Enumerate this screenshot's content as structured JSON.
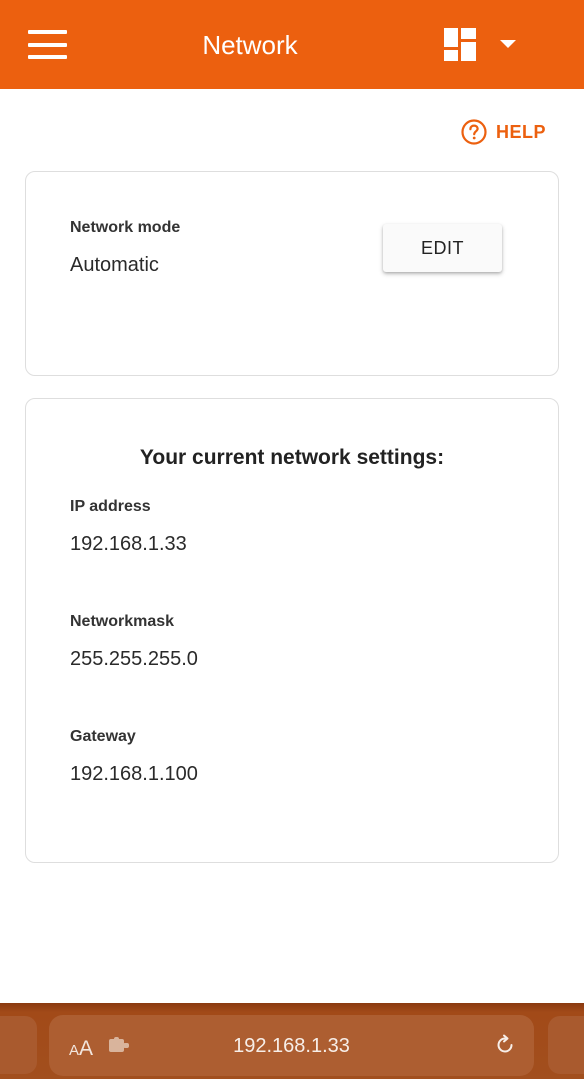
{
  "header": {
    "title": "Network",
    "menu_icon": "hamburger-menu-icon",
    "dashboard_icon": "dashboard-layout-icon",
    "dropdown_icon": "caret-down-icon",
    "background": "#ec600f"
  },
  "help": {
    "label": "HELP",
    "icon": "question-circle-icon",
    "color": "#ec600f"
  },
  "network_mode": {
    "label": "Network mode",
    "value": "Automatic",
    "edit_label": "EDIT"
  },
  "current_settings": {
    "title": "Your current network settings:",
    "fields": [
      {
        "label": "IP address",
        "value": "192.168.1.33"
      },
      {
        "label": "Networkmask",
        "value": "255.255.255.0"
      },
      {
        "label": "Gateway",
        "value": "192.168.1.100"
      }
    ]
  },
  "browser": {
    "text_size_small": "A",
    "text_size_large": "A",
    "url": "192.168.1.33",
    "extension_icon": "puzzle-extension-icon",
    "reload_icon": "reload-icon"
  }
}
